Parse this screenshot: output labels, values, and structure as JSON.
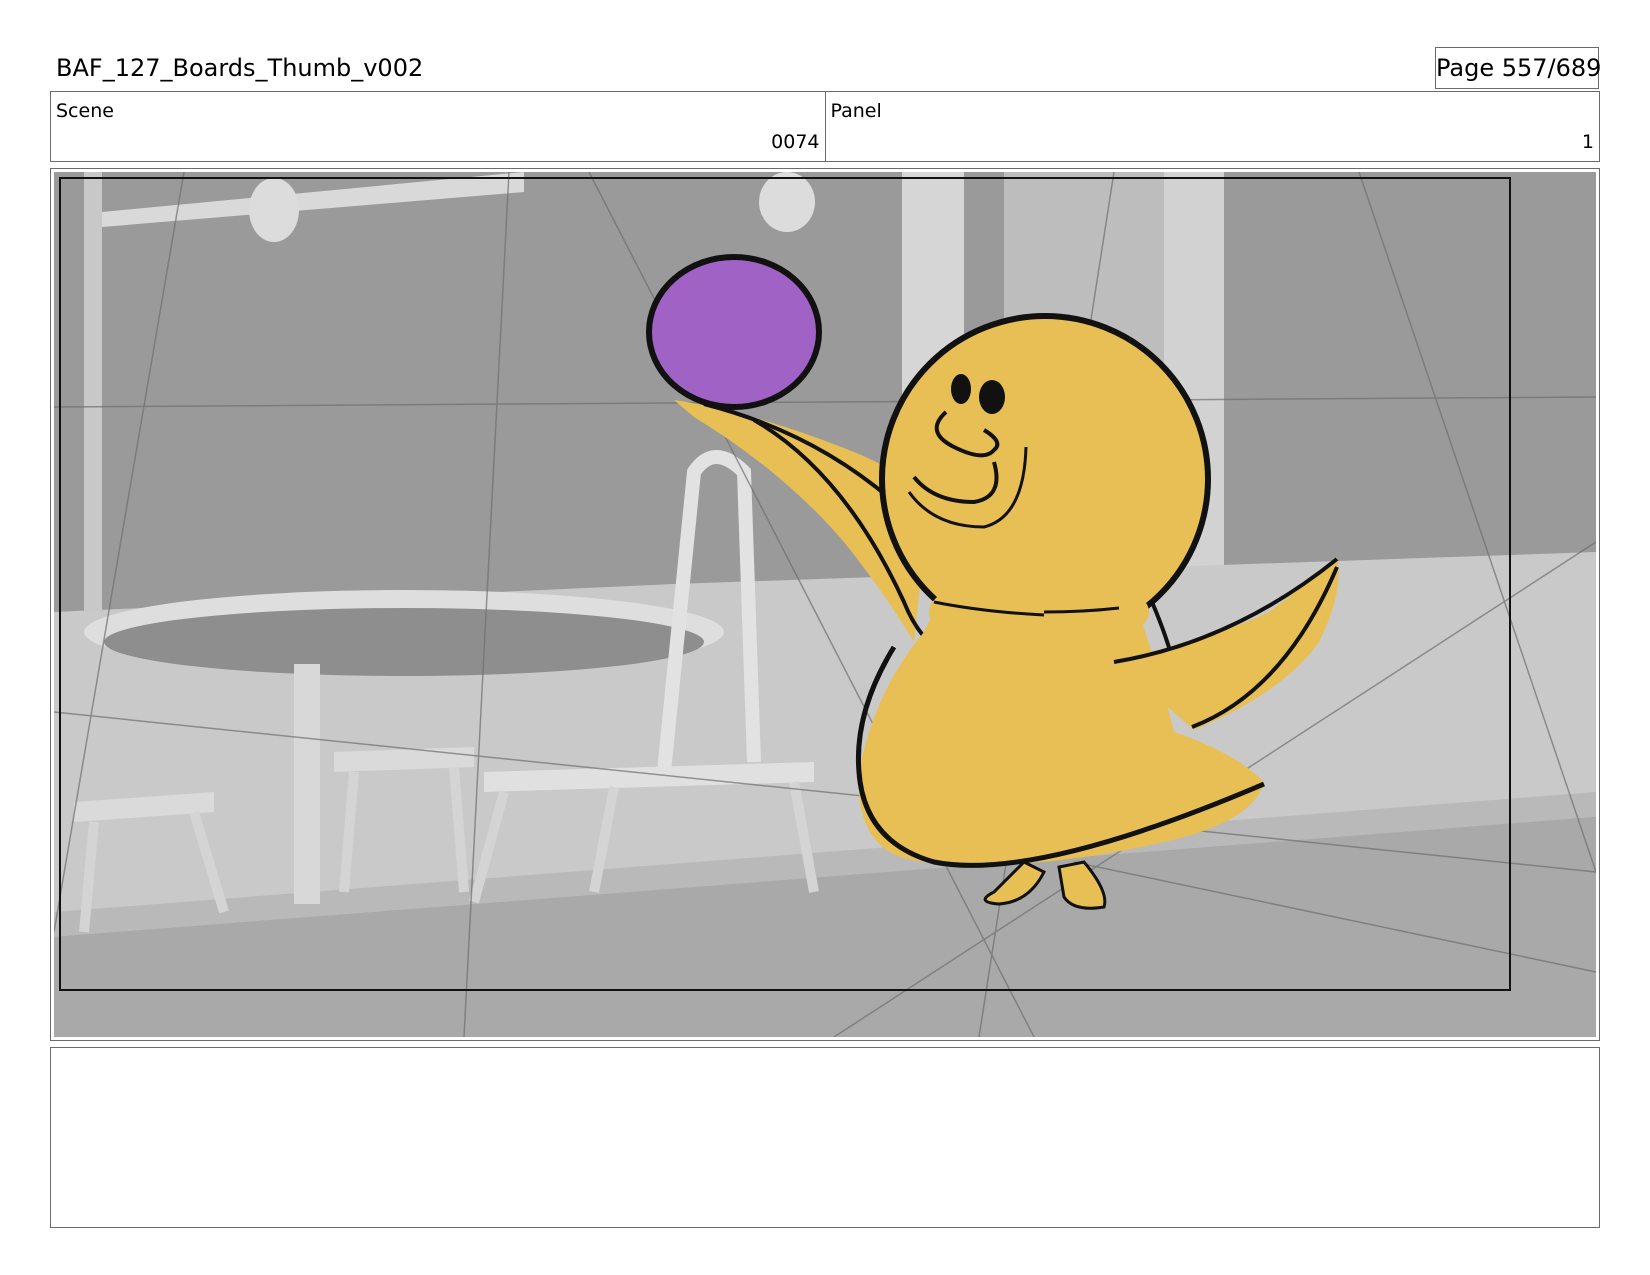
{
  "document": {
    "title": "BAF_127_Boards_Thumb_v002",
    "page_label": "Page 557/689"
  },
  "header": {
    "scene_label": "Scene",
    "scene_value": "0074",
    "panel_label": "Panel",
    "panel_value": "1"
  },
  "panel_image": {
    "subject": "yellow chick character holding up a purple ball",
    "background": "grey cafe interior with tables and chairs"
  },
  "colors": {
    "chick": "#e8bf55",
    "ball": "#a062c4",
    "outline": "#111111",
    "background_grey": "#9a9a9a"
  },
  "notes": {
    "text": ""
  }
}
